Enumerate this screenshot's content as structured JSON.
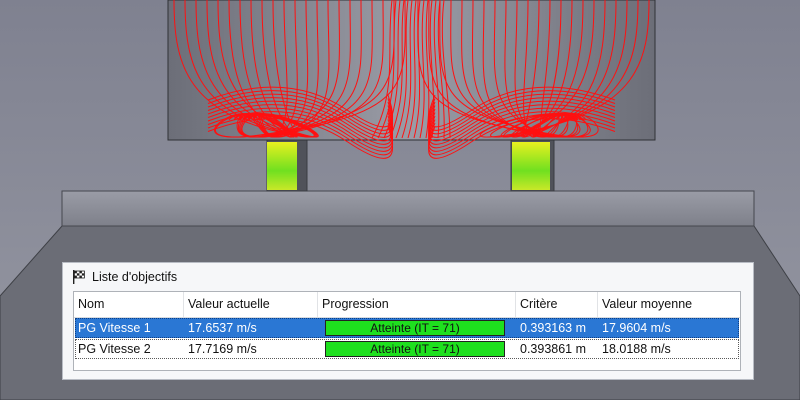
{
  "panel": {
    "title": "Liste d'objectifs",
    "icon": "checkered-flag-icon",
    "columns": [
      "Nom",
      "Valeur actuelle",
      "Progression",
      "Critère",
      "Valeur moyenne"
    ],
    "rows": [
      {
        "name": "PG Vitesse 1",
        "current": "17.6537 m/s",
        "progress_label": "Atteinte (IT = 71)",
        "progress_fraction": 1.0,
        "criterion": "0.393163 m",
        "average": "17.9604 m/s",
        "selected": true
      },
      {
        "name": "PG Vitesse 2",
        "current": "17.7169 m/s",
        "progress_label": "Atteinte (IT = 71)",
        "progress_fraction": 1.0,
        "criterion": "0.393861 m",
        "average": "18.0188 m/s",
        "selected": false
      }
    ]
  },
  "colors": {
    "background": "#8a8d98",
    "streamlines": "#ff1010",
    "progress_fill": "#1ee01e",
    "selection": "#2a77d4"
  }
}
